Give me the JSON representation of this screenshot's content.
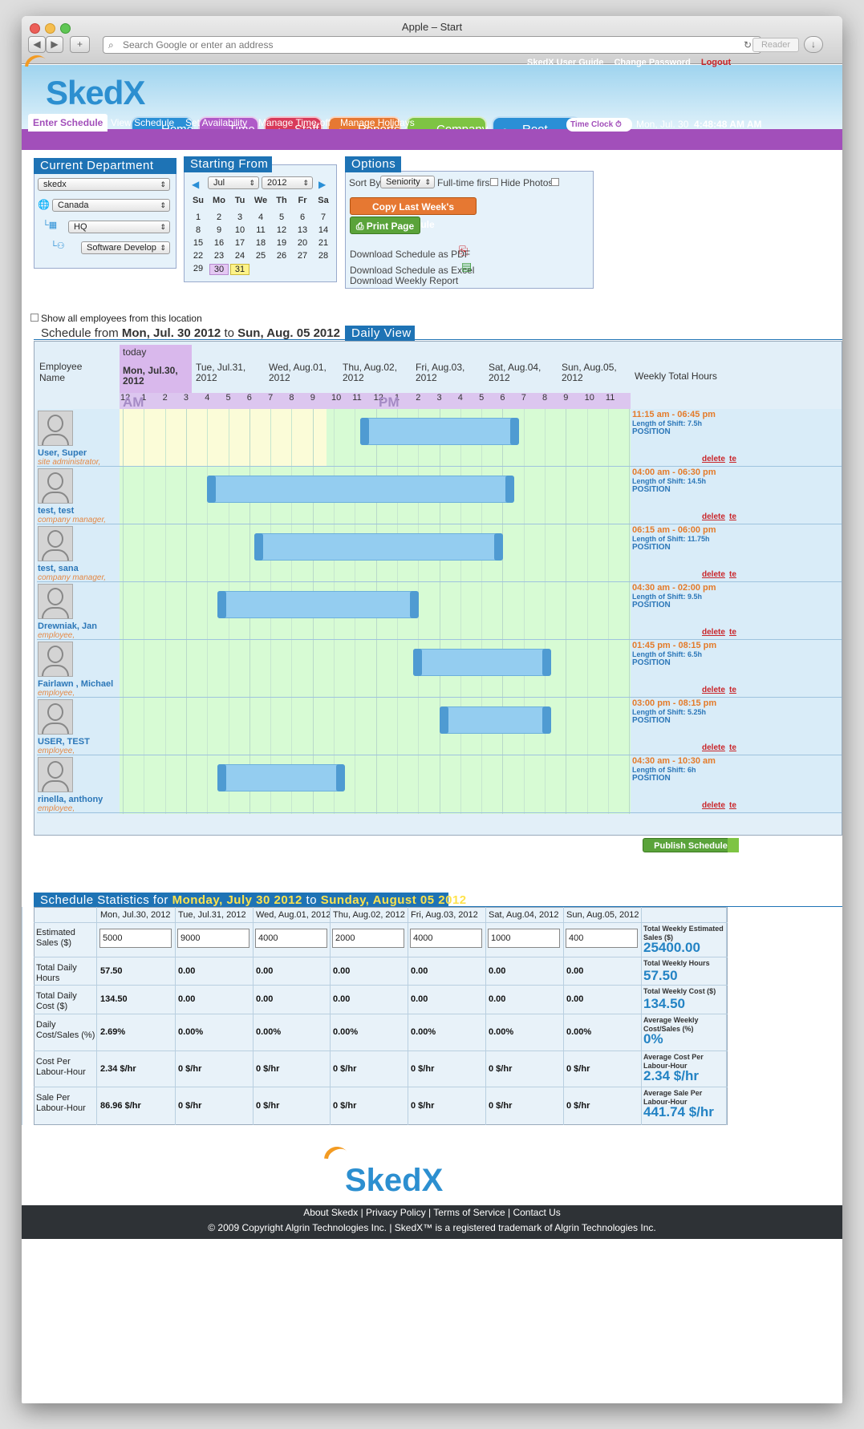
{
  "browser": {
    "title": "Apple – Start",
    "address_placeholder": "Search Google or enter an address",
    "reader_label": "Reader"
  },
  "header": {
    "logo_text": "SkedX",
    "links": [
      "SkedX User Guide",
      "Change Password",
      "Logout"
    ],
    "tabs": [
      {
        "label": "Home",
        "color": "#2a8fd6",
        "icon": "home-icon"
      },
      {
        "label": "Time",
        "color": "#b05ac8",
        "icon": "clock-icon"
      },
      {
        "label": "Staff",
        "color": "#d83a5a",
        "icon": "person-icon"
      },
      {
        "label": "Reports",
        "color": "#e67832",
        "icon": "edit-icon"
      },
      {
        "label": "Company",
        "color": "#7ec443",
        "icon": "grid-icon"
      },
      {
        "label": "Root Tasks",
        "color": "#2a8fd6",
        "icon": "edit-icon"
      }
    ],
    "subnav": [
      "Enter Schedule",
      "View Schedule",
      "Set Availability",
      "Manage Time-off",
      "Manage Holidays"
    ],
    "time_clock_label": "Time Clock",
    "clock_date": "Mon, Jul. 30",
    "clock_time": "4:48:48 AM AM"
  },
  "department": {
    "title": "Current Department",
    "company": "skedx",
    "country": "Canada",
    "location": "HQ",
    "department": "Software Develop"
  },
  "calendar": {
    "title": "Starting From",
    "month": "Jul",
    "year": "2012",
    "weekdays": [
      "Su",
      "Mo",
      "Tu",
      "We",
      "Th",
      "Fr",
      "Sa"
    ],
    "weeks": [
      [
        "1",
        "2",
        "3",
        "4",
        "5",
        "6",
        "7"
      ],
      [
        "8",
        "9",
        "10",
        "11",
        "12",
        "13",
        "14"
      ],
      [
        "15",
        "16",
        "17",
        "18",
        "19",
        "20",
        "21"
      ],
      [
        "22",
        "23",
        "24",
        "25",
        "26",
        "27",
        "28"
      ],
      [
        "29",
        "30",
        "31",
        "",
        "",
        "",
        ""
      ]
    ]
  },
  "options": {
    "title": "Options",
    "sort_by_label": "Sort By",
    "sort_by_value": "Seniority",
    "fulltime_label": "Full-time first",
    "hide_photos_label": "Hide Photos",
    "copy_button": "Copy Last Week's Schedule",
    "print_button": "Print Page",
    "links": [
      "Download Schedule as PDF",
      "Download Schedule as Excel",
      "Download Weekly Report"
    ]
  },
  "schedule": {
    "show_all_label": "Show all employees from this location",
    "title_prefix": "Schedule from",
    "from": "Mon, Jul. 30 2012",
    "to_word": "to",
    "to": "Sun, Aug. 05 2012",
    "view_label": "Daily View",
    "employee_header": "Employee Name",
    "today_label": "today",
    "days": [
      "Mon, Jul.30, 2012",
      "Tue, Jul.31, 2012",
      "Wed, Aug.01, 2012",
      "Thu, Aug.02, 2012",
      "Fri, Aug.03, 2012",
      "Sat, Aug.04, 2012",
      "Sun, Aug.05, 2012"
    ],
    "weekly_total_header": "Weekly Total Hours",
    "hours": [
      "12",
      "1",
      "2",
      "3",
      "4",
      "5",
      "6",
      "7",
      "8",
      "9",
      "10",
      "11",
      "12",
      "1",
      "2",
      "3",
      "4",
      "5",
      "6",
      "7",
      "8",
      "9",
      "10",
      "11"
    ],
    "am_label": "AM",
    "pm_label": "PM",
    "publish_button": "Publish Schedule",
    "employees": [
      {
        "name": "User, Super",
        "role": "site administrator,",
        "start": 11.25,
        "end": 18.75,
        "time": "11:15 am - 06:45 pm",
        "length": "Length of Shift: 7.5h",
        "position": "POSITION"
      },
      {
        "name": "test, test",
        "role": "company manager,",
        "start": 4.0,
        "end": 18.5,
        "time": "04:00 am - 06:30 pm",
        "length": "Length of Shift: 14.5h",
        "position": "POSITION"
      },
      {
        "name": "test, sana",
        "role": "company manager,",
        "start": 6.25,
        "end": 18.0,
        "time": "06:15 am - 06:00 pm",
        "length": "Length of Shift: 11.75h",
        "position": "POSITION"
      },
      {
        "name": "Drewniak, Jan",
        "role": "employee,",
        "start": 4.5,
        "end": 14.0,
        "time": "04:30 am - 02:00 pm",
        "length": "Length of Shift: 9.5h",
        "position": "POSITION"
      },
      {
        "name": "Fairlawn , Michael",
        "role": "employee,",
        "start": 13.75,
        "end": 20.25,
        "time": "01:45 pm - 08:15 pm",
        "length": "Length of Shift: 6.5h",
        "position": "POSITION"
      },
      {
        "name": "USER, TEST",
        "role": "employee,",
        "start": 15.0,
        "end": 20.25,
        "time": "03:00 pm - 08:15 pm",
        "length": "Length of Shift: 5.25h",
        "position": "POSITION"
      },
      {
        "name": "rinella, anthony",
        "role": "employee,",
        "start": 4.5,
        "end": 10.5,
        "time": "04:30 am - 10:30 am",
        "length": "Length of Shift: 6h",
        "position": "POSITION"
      }
    ],
    "delete_label": "delete",
    "extra_label": "te"
  },
  "stats": {
    "title_prefix": "Schedule Statistics for",
    "from": "Monday, July 30 2012",
    "to_word": "to",
    "to": "Sunday, August 05 2012",
    "days": [
      "Mon, Jul.30, 2012",
      "Tue, Jul.31, 2012",
      "Wed, Aug.01, 2012",
      "Thu, Aug.02, 2012",
      "Fri, Aug.03, 2012",
      "Sat, Aug.04, 2012",
      "Sun, Aug.05, 2012"
    ],
    "rows": [
      {
        "label": "Estimated Sales ($)",
        "values": [
          "5000",
          "9000",
          "4000",
          "2000",
          "4000",
          "1000",
          "400"
        ],
        "total_label": "Total Weekly Estimated Sales ($)",
        "total": "25400.00"
      },
      {
        "label": "Total Daily Hours",
        "values": [
          "57.50",
          "0.00",
          "0.00",
          "0.00",
          "0.00",
          "0.00",
          "0.00"
        ],
        "total_label": "Total Weekly Hours",
        "total": "57.50"
      },
      {
        "label": "Total Daily Cost ($)",
        "values": [
          "134.50",
          "0.00",
          "0.00",
          "0.00",
          "0.00",
          "0.00",
          "0.00"
        ],
        "total_label": "Total Weekly Cost ($)",
        "total": "134.50"
      },
      {
        "label": "Daily Cost/Sales (%)",
        "values": [
          "2.69%",
          "0.00%",
          "0.00%",
          "0.00%",
          "0.00%",
          "0.00%",
          "0.00%"
        ],
        "total_label": "Average Weekly Cost/Sales (%)",
        "total": "0%"
      },
      {
        "label": "Cost Per Labour-Hour",
        "values": [
          "2.34 $/hr",
          "0 $/hr",
          "0 $/hr",
          "0 $/hr",
          "0 $/hr",
          "0 $/hr",
          "0 $/hr"
        ],
        "total_label": "Average Cost Per Labour-Hour",
        "total": "2.34 $/hr"
      },
      {
        "label": "Sale Per Labour-Hour",
        "values": [
          "86.96 $/hr",
          "0 $/hr",
          "0 $/hr",
          "0 $/hr",
          "0 $/hr",
          "0 $/hr",
          "0 $/hr"
        ],
        "total_label": "Average Sale Per Labour-Hour",
        "total": "441.74 $/hr"
      }
    ]
  },
  "footer": {
    "logo_text": "SkedX",
    "links": [
      "About Skedx",
      "Privacy Policy",
      "Terms of Service",
      "Contact Us"
    ],
    "copyright": "© 2009 Copyright Algrin Technologies Inc. | SkedX™ is a registered trademark of Algrin Technologies Inc."
  }
}
